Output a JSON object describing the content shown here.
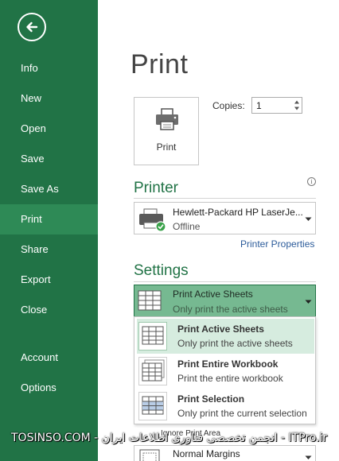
{
  "sidebar": {
    "items": [
      {
        "label": "Info"
      },
      {
        "label": "New"
      },
      {
        "label": "Open"
      },
      {
        "label": "Save"
      },
      {
        "label": "Save As"
      },
      {
        "label": "Print",
        "active": true
      },
      {
        "label": "Share"
      },
      {
        "label": "Export"
      },
      {
        "label": "Close"
      },
      {
        "label": "Account"
      },
      {
        "label": "Options"
      }
    ],
    "back_icon": "back-arrow-icon"
  },
  "page": {
    "title": "Print"
  },
  "print_button": {
    "label": "Print",
    "icon": "printer-icon"
  },
  "copies": {
    "label": "Copies:",
    "value": "1"
  },
  "printer": {
    "heading": "Printer",
    "name": "Hewlett-Packard HP LaserJe...",
    "status": "Offline",
    "properties_link": "Printer Properties"
  },
  "settings": {
    "heading": "Settings",
    "selected": {
      "title": "Print Active Sheets",
      "subtitle": "Only print the active sheets"
    },
    "options": [
      {
        "title": "Print Active Sheets",
        "subtitle": "Only print the active sheets",
        "highlighted": true
      },
      {
        "title": "Print Entire Workbook",
        "subtitle": "Print the entire workbook"
      },
      {
        "title": "Print Selection",
        "subtitle": "Only print the current selection"
      }
    ],
    "ignore_print_area": "Ignore Print Area",
    "margins": {
      "title": "Normal Margins"
    }
  },
  "watermark": "TOSINSO.COM - انجمن تخصصی فناوری اطلاعات ایران - ITPro.ir",
  "colors": {
    "sidebar": "#217346",
    "sidebar_active": "#2e8a56",
    "accent": "#217346",
    "selected_fill": "#76b991",
    "menu_highlight": "#d6ecdf",
    "link": "#2b5b9a"
  }
}
